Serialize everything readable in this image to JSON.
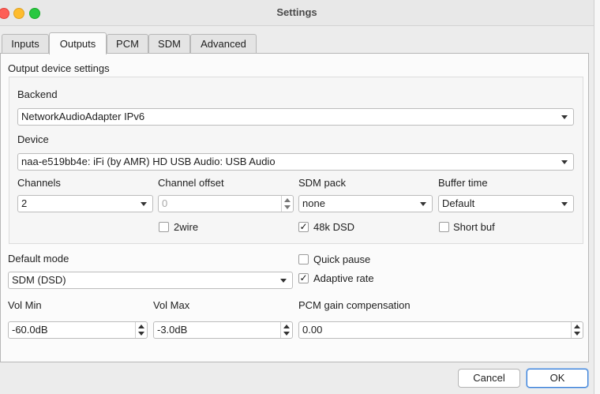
{
  "window": {
    "title": "Settings"
  },
  "tabs": [
    {
      "label": "Inputs"
    },
    {
      "label": "Outputs"
    },
    {
      "label": "PCM"
    },
    {
      "label": "SDM"
    },
    {
      "label": "Advanced"
    }
  ],
  "output_group": {
    "title": "Output device settings",
    "backend": {
      "label": "Backend",
      "value": "NetworkAudioAdapter IPv6"
    },
    "device": {
      "label": "Device",
      "value": "naa-e519bb4e: iFi (by AMR) HD USB Audio: USB Audio"
    },
    "channels": {
      "label": "Channels",
      "value": "2"
    },
    "channel_offset": {
      "label": "Channel offset",
      "value": "0"
    },
    "sdm_pack": {
      "label": "SDM pack",
      "value": "none"
    },
    "buffer_time": {
      "label": "Buffer time",
      "value": "Default"
    },
    "twowire": {
      "label": "2wire",
      "checked": false
    },
    "dsd48k": {
      "label": "48k DSD",
      "checked": true
    },
    "short_buf": {
      "label": "Short buf",
      "checked": false
    }
  },
  "default_mode": {
    "label": "Default mode",
    "value": "SDM (DSD)"
  },
  "quick_pause": {
    "label": "Quick pause",
    "checked": false
  },
  "adaptive_rate": {
    "label": "Adaptive rate",
    "checked": true
  },
  "vol_min": {
    "label": "Vol Min",
    "value": "-60.0dB"
  },
  "vol_max": {
    "label": "Vol Max",
    "value": "-3.0dB"
  },
  "pcm_gain": {
    "label": "PCM gain compensation",
    "value": "0.00"
  },
  "buttons": {
    "cancel": "Cancel",
    "ok": "OK"
  },
  "marks": {
    "check": "✓"
  }
}
